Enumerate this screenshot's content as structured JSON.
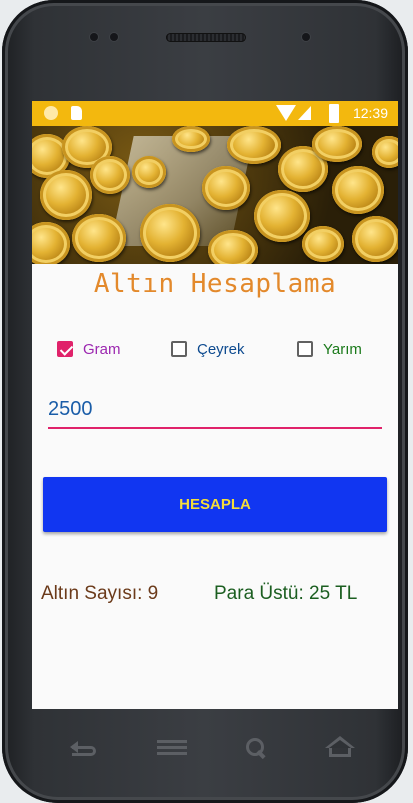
{
  "status_bar": {
    "time": "12:39"
  },
  "app": {
    "title": "Altın Hesaplama",
    "options": [
      {
        "label": "Gram",
        "checked": true
      },
      {
        "label": "Çeyrek",
        "checked": false
      },
      {
        "label": "Yarım",
        "checked": false
      }
    ],
    "amount_input": {
      "value": "2500"
    },
    "calculate_button": {
      "label": "HESAPLA"
    },
    "results": {
      "gold_count": "Altın Sayısı: 9",
      "change": "Para Üstü: 25 TL"
    }
  },
  "colors": {
    "status_bar": "#f3b80e",
    "title": "#e3892b",
    "accent": "#e0226a",
    "button": "#1136f1",
    "button_text": "#f4dd3a"
  },
  "icons": {
    "nav": [
      "back-icon",
      "menu-icon",
      "search-icon",
      "home-icon"
    ]
  }
}
